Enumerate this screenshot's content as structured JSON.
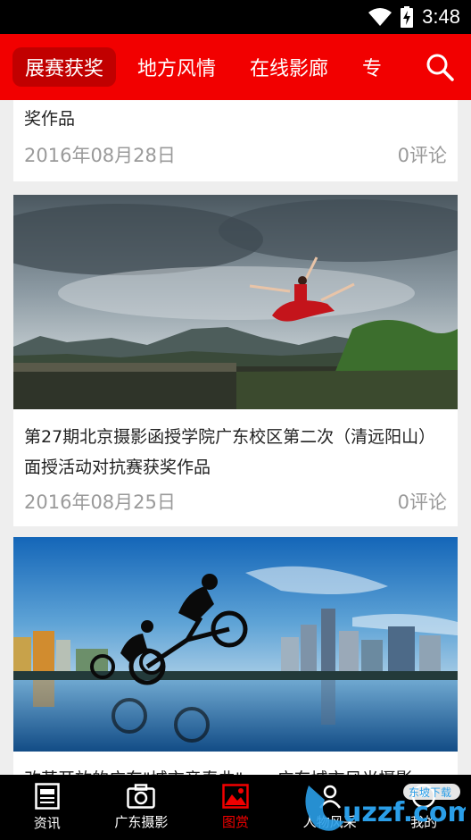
{
  "status_bar": {
    "time": "3:48"
  },
  "top_nav": {
    "tabs": [
      {
        "label": "展赛获奖",
        "active": true
      },
      {
        "label": "地方风情",
        "active": false
      },
      {
        "label": "在线影廊",
        "active": false
      },
      {
        "label": "专",
        "active": false
      }
    ],
    "search_icon": "search-icon"
  },
  "articles": [
    {
      "title_tail": "奖作品",
      "date": "2016年08月28日",
      "comments": "0评论"
    },
    {
      "title": "第27期北京摄影函授学院广东校区第二次（清远阳山）面授活动对抗赛获奖作品",
      "image": "dancer-on-cliff-photo",
      "date": "2016年08月25日",
      "comments": "0评论"
    },
    {
      "title": "改革开放的广东\"城市竞春曲\"——广东城市风光摄影",
      "image": "bmx-riders-city-photo"
    }
  ],
  "bottom_nav": {
    "items": [
      {
        "label": "资讯",
        "icon": "news-icon",
        "active": false
      },
      {
        "label": "广东摄影",
        "icon": "camera-icon",
        "active": false
      },
      {
        "label": "图赏",
        "icon": "picture-icon",
        "active": true
      },
      {
        "label": "人物风采",
        "icon": "person-icon",
        "active": false
      },
      {
        "label": "我的",
        "icon": "profile-icon",
        "active": false
      }
    ]
  },
  "watermark": {
    "text": "uzzf.com",
    "badge": "东坡下载"
  },
  "colors": {
    "brand_red": "#f20000",
    "active_tab_bg": "#c10000",
    "meta_gray": "#9a9a9a"
  }
}
